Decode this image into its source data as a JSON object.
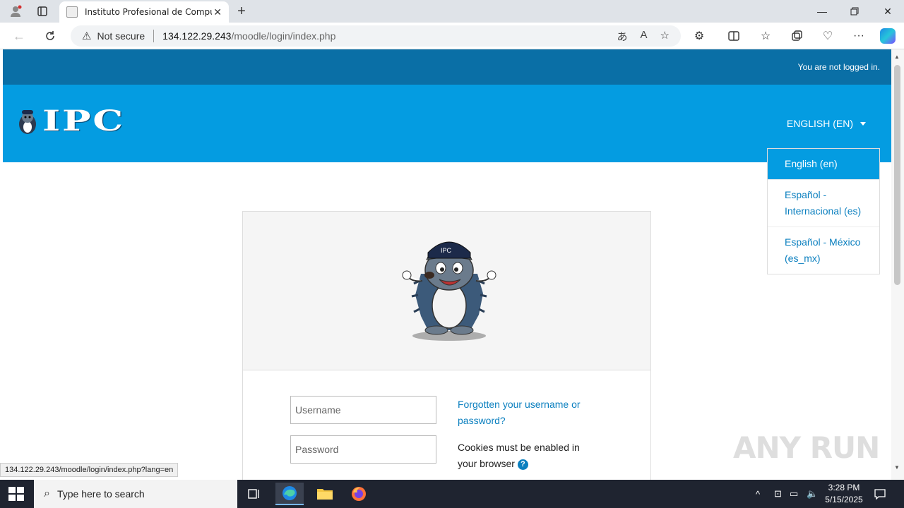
{
  "browser": {
    "tab_title": "Instituto Profesional de Computa",
    "not_secure_label": "Not secure",
    "url_host": "134.122.29.243",
    "url_path": "/moodle/login/index.php",
    "status_url": "134.122.29.243/moodle/login/index.php?lang=en"
  },
  "page": {
    "login_status": "You are not logged in.",
    "logo_text": "IPC",
    "language_toggle": "ENGLISH (EN)",
    "language_options": [
      {
        "label": "English (en)",
        "active": true
      },
      {
        "label": "Español - Internacional (es)",
        "active": false
      },
      {
        "label": "Español - México (es_mx)",
        "active": false
      }
    ],
    "username_placeholder": "Username",
    "password_placeholder": "Password",
    "forgot_link": "Forgotten your username or password?",
    "cookies_notice": "Cookies must be enabled in your browser",
    "mascot_cap_text": "IPC"
  },
  "watermark": "ANY RUN",
  "taskbar": {
    "search_placeholder": "Type here to search",
    "time": "3:28 PM",
    "date": "5/15/2025"
  },
  "colors": {
    "topnav": "#0a6fa6",
    "header": "#049ce1",
    "link": "#0a7fbf"
  }
}
